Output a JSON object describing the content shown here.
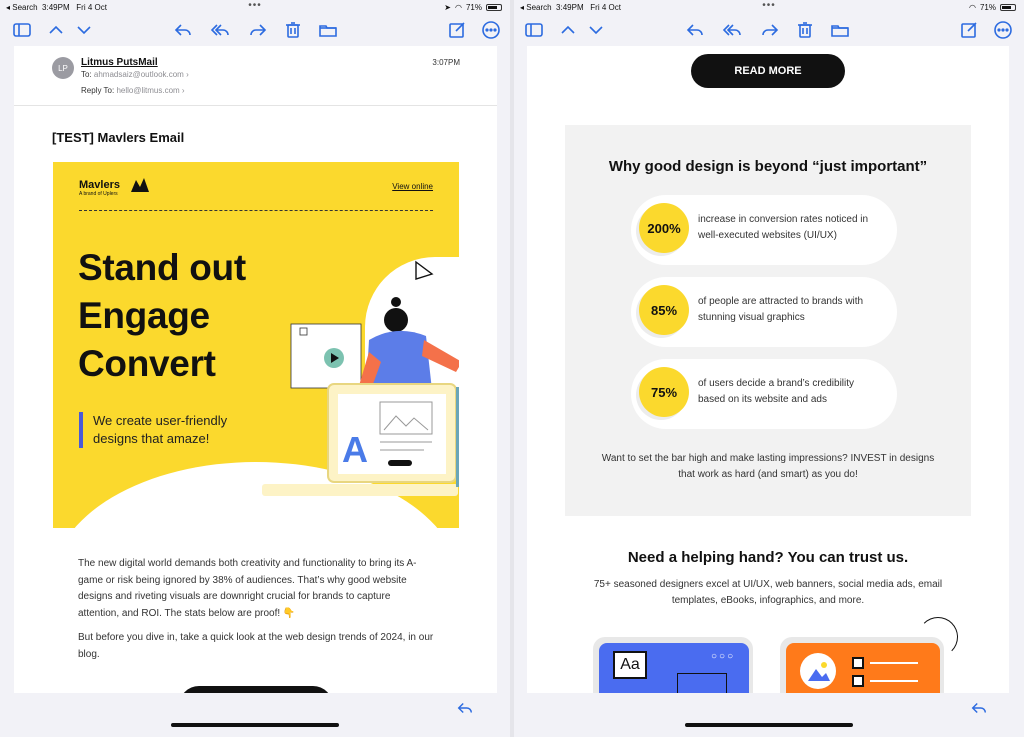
{
  "status_left": {
    "carrier": "◂ Search",
    "time": "3:49PM",
    "date": "Fri 4 Oct",
    "battery": "71%"
  },
  "status_right": {
    "carrier": "◂ Search",
    "time": "3:49PM",
    "date": "Fri 4 Oct",
    "battery": "71%"
  },
  "mail": {
    "avatar_initials": "LP",
    "sender": "Litmus PutsMail",
    "to_label": "To:",
    "to_addr": "ahmadsaiz@outlook.com",
    "reply_label": "Reply To:",
    "reply_addr": "hello@litmus.com",
    "time": "3:07PM",
    "subject": "[TEST] Mavlers Email"
  },
  "hero": {
    "brand": "Mavlers",
    "brand_sub": "A brand of Uplers",
    "view_online": "View online",
    "title_lines": [
      "Stand out",
      "Engage",
      "Convert"
    ],
    "tagline": "We create user-friendly designs that amaze!"
  },
  "body": {
    "para1": "The new digital world demands both creativity and functionality to bring its A-game or risk being ignored by 38% of audiences. That’s why good website designs and riveting visuals are downright crucial for brands to capture attention, and ROI. The stats below are proof! 👇",
    "para2": "But before you dive in, take a quick look at the web design trends of 2024, in our blog."
  },
  "right": {
    "read_more": "READ MORE",
    "stats_title": "Why good design is beyond “just important”",
    "stats": [
      {
        "value": "200%",
        "text": "increase in conversion rates noticed in well-executed websites (UI/UX)"
      },
      {
        "value": "85%",
        "text": "of people are attracted to brands with stunning visual graphics"
      },
      {
        "value": "75%",
        "text": "of users decide a brand’s credibility based on its website and ads"
      }
    ],
    "stats_foot": "Want to set the bar high and make lasting impressions? INVEST in designs that work as hard (and smart) as you do!",
    "help_title": "Need a helping hand? You can trust us.",
    "help_text": "75+ seasoned designers excel at UI/UX, web banners, social media ads, email templates, eBooks, infographics, and more.",
    "card_blue_label": "Aa"
  },
  "colors": {
    "accent": "#2c6be0",
    "yellow": "#fbd92d",
    "brand_blue": "#4a5ad8",
    "orange": "#ff7a1a"
  }
}
